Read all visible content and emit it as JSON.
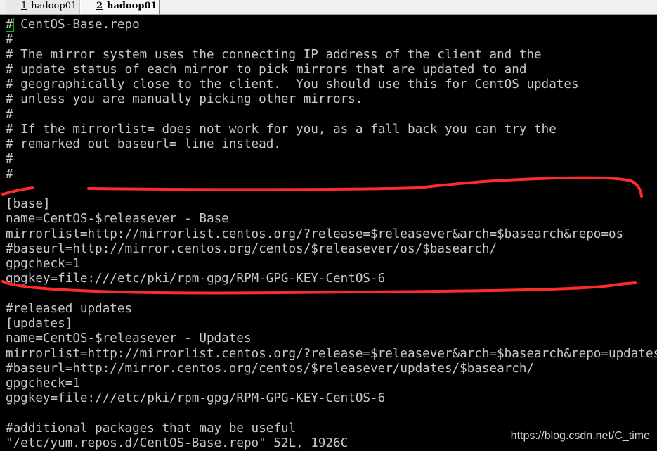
{
  "tabs": [
    {
      "num": "1",
      "label": "hadoop01"
    },
    {
      "num": "2",
      "label": "hadoop01",
      "active": true
    }
  ],
  "lines": [
    "# CentOS-Base.repo",
    "#",
    "# The mirror system uses the connecting IP address of the client and the",
    "# update status of each mirror to pick mirrors that are updated to and",
    "# geographically close to the client.  You should use this for CentOS updates",
    "# unless you are manually picking other mirrors.",
    "#",
    "# If the mirrorlist= does not work for you, as a fall back you can try the",
    "# remarked out baseurl= line instead.",
    "#",
    "#",
    "",
    "[base]",
    "name=CentOS-$releasever - Base",
    "mirrorlist=http://mirrorlist.centos.org/?release=$releasever&arch=$basearch&repo=os",
    "#baseurl=http://mirror.centos.org/centos/$releasever/os/$basearch/",
    "gpgcheck=1",
    "gpgkey=file:///etc/pki/rpm-gpg/RPM-GPG-KEY-CentOS-6",
    "",
    "#released updates",
    "[updates]",
    "name=CentOS-$releasever - Updates",
    "mirrorlist=http://mirrorlist.centos.org/?release=$releasever&arch=$basearch&repo=updates",
    "#baseurl=http://mirror.centos.org/centos/$releasever/updates/$basearch/",
    "gpgcheck=1",
    "gpgkey=file:///etc/pki/rpm-gpg/RPM-GPG-KEY-CentOS-6",
    "",
    "#additional packages that may be useful",
    "\"/etc/yum.repos.d/CentOS-Base.repo\" 52L, 1926C"
  ],
  "watermark": "https://blog.csdn.net/C_time",
  "colors": {
    "text": "#c8c8c8",
    "background": "#000000",
    "cursor": "#00c000",
    "annotation": "#ff2a2a"
  }
}
